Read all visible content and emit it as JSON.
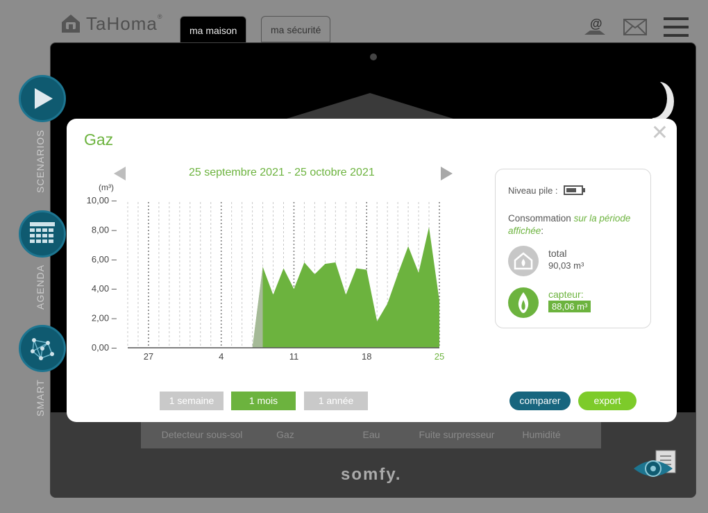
{
  "header": {
    "logo_text": "TaHoma",
    "logo_reg": "®",
    "tabs": [
      {
        "label": "ma maison",
        "active": true
      },
      {
        "label": "ma sécurité",
        "active": false
      }
    ],
    "icons": [
      "contact-at-icon",
      "mail-icon",
      "hamburger-menu-icon"
    ]
  },
  "sidebar": {
    "items": [
      {
        "label": "SCENARIOS",
        "icon": "play-icon"
      },
      {
        "label": "AGENDA",
        "icon": "calendar-icon"
      },
      {
        "label": "SMART",
        "icon": "network-icon"
      }
    ]
  },
  "devices": [
    {
      "label": "Detecteur sous-sol"
    },
    {
      "label": "Gaz"
    },
    {
      "label": "Eau"
    },
    {
      "label": "Fuite surpresseur"
    },
    {
      "label": "Humidité"
    }
  ],
  "footer": {
    "brand": "somfy."
  },
  "modal": {
    "title": "Gaz",
    "close_symbol": "✕",
    "period": "25 septembre 2021 - 25 octobre 2021",
    "range_buttons": [
      {
        "label": "1 semaine",
        "active": false
      },
      {
        "label": "1 mois",
        "active": true
      },
      {
        "label": "1 année",
        "active": false
      }
    ],
    "compare_label": "comparer",
    "export_label": "export",
    "info": {
      "battery_label": "Niveau pile :",
      "conso_prefix": "Consommation",
      "conso_suffix": "sur la période affichée",
      "conso_colon": ":",
      "total_label": "total",
      "total_value": "90,03 m³",
      "sensor_label": "capteur:",
      "sensor_value": "88,06 m³"
    }
  },
  "colors": {
    "accent_green": "#6cb33e",
    "bright_green": "#7dcb2a",
    "teal": "#17657e",
    "gray_button": "#c9c9c9"
  },
  "chart_data": {
    "type": "area",
    "ylabel": "(m³)",
    "ylim": [
      0,
      10
    ],
    "yticks": [
      "0,00",
      "2,00",
      "4,00",
      "6,00",
      "8,00",
      "10,00"
    ],
    "xticks": [
      {
        "label": "27",
        "day": 2
      },
      {
        "label": "4",
        "day": 9
      },
      {
        "label": "11",
        "day": 16
      },
      {
        "label": "18",
        "day": 23
      },
      {
        "label": "25",
        "day": 30
      }
    ],
    "days": [
      0,
      1,
      2,
      3,
      4,
      5,
      6,
      7,
      8,
      9,
      10,
      11,
      12,
      13,
      14,
      15,
      16,
      17,
      18,
      19,
      20,
      21,
      22,
      23,
      24,
      25,
      26,
      27,
      28,
      29,
      30
    ],
    "values": [
      0,
      0,
      0,
      0,
      0,
      0,
      0,
      0,
      0,
      0,
      0,
      0,
      0,
      5.5,
      3.6,
      5.4,
      4.0,
      5.8,
      5.0,
      5.7,
      5.8,
      3.6,
      5.4,
      5.3,
      1.8,
      3.0,
      5.0,
      6.9,
      5.1,
      8.2,
      3.2
    ],
    "series_color": "#6cb33e",
    "grid": "vertical-dashed"
  }
}
